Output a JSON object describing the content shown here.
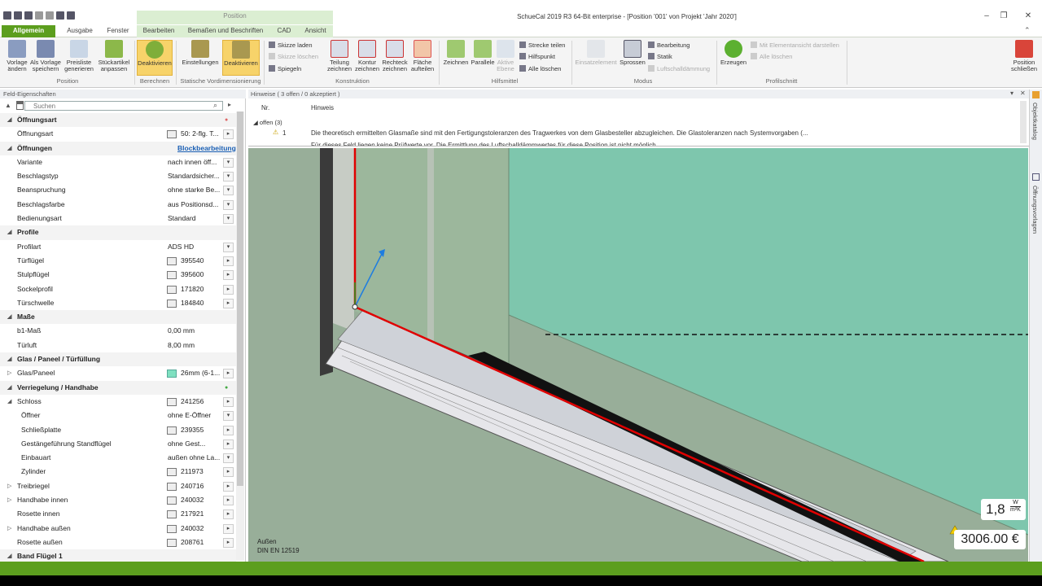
{
  "window": {
    "title": "SchueCal 2019 R3 64-Bit enterprise - [Position '001' von Projekt 'Jahr 2020']",
    "context_group": "Position"
  },
  "tabs": [
    "Allgemein",
    "Ausgabe",
    "Fenster",
    "Bearbeiten",
    "Bemaßen und Beschriften",
    "CAD",
    "Ansicht"
  ],
  "ribbon": {
    "position": {
      "b1": "Vorlage ändern",
      "b2": "Als Vorlage speichern",
      "b3": "Preisliste generieren",
      "b4": "Stückartikel anpassen",
      "label": "Position"
    },
    "berechnen": {
      "b1": "Deaktivieren",
      "label": "Berechnen"
    },
    "statik": {
      "b1": "Einstellungen",
      "b2": "Deaktivieren",
      "label": "Statische Vordimensionierung"
    },
    "skizze": {
      "s1": "Skizze laden",
      "s2": "Skizze löschen",
      "s3": "Spiegeln"
    },
    "konstruktion": {
      "b1": "Teilung zeichnen",
      "b2": "Kontur zeichnen",
      "b3": "Rechteck zeichnen",
      "b4": "Fläche aufteilen",
      "label": "Konstruktion"
    },
    "hilfsmittel": {
      "b1": "Zeichnen",
      "b2": "Parallele",
      "b3": "Aktive Ebene",
      "s1": "Strecke teilen",
      "s2": "Hilfspunkt",
      "s3": "Alle löschen",
      "label": "Hilfsmittel"
    },
    "modus": {
      "b1": "Einsatzelement",
      "b2": "Sprossen",
      "s1": "Bearbeitung",
      "s2": "Statik",
      "s3": "Luftschalldämmung",
      "label": "Modus"
    },
    "profilschnitt": {
      "b1": "Erzeugen",
      "s1": "Mit Elementansicht darstellen",
      "s2": "Alle löschen",
      "label": "Profilschnitt"
    },
    "close": {
      "b1": "Position schließen"
    }
  },
  "left_panel": {
    "title": "Feld-Eigenschaften",
    "search_placeholder": "Suchen",
    "rows": [
      {
        "type": "sec",
        "label": "Öffnungsart"
      },
      {
        "type": "row",
        "label": "Öffnungsart",
        "value": "50: 2-flg. T...",
        "icon": true,
        "btn": "▸"
      },
      {
        "type": "sec",
        "label": "Öffnungen",
        "link": "Blockbearbeitung"
      },
      {
        "type": "row",
        "label": "Variante",
        "value": "nach innen öff...",
        "btn": "▾"
      },
      {
        "type": "row",
        "label": "Beschlagstyp",
        "value": "Standardsicher...",
        "btn": "▾"
      },
      {
        "type": "row",
        "label": "Beanspruchung",
        "value": "ohne starke Be...",
        "btn": "▾"
      },
      {
        "type": "row",
        "label": "Beschlagsfarbe",
        "value": "aus Positionsd...",
        "btn": "▾"
      },
      {
        "type": "row",
        "label": "Bedienungsart",
        "value": "Standard",
        "btn": "▾"
      },
      {
        "type": "sec",
        "label": "Profile"
      },
      {
        "type": "row",
        "label": "Profilart",
        "value": "ADS HD",
        "btn": "▾"
      },
      {
        "type": "row",
        "label": "Türflügel",
        "value": "395540",
        "icon": true,
        "btn": "▸"
      },
      {
        "type": "row",
        "label": "Stulpflügel",
        "value": "395600",
        "icon": true,
        "btn": "▸"
      },
      {
        "type": "row",
        "label": "Sockelprofil",
        "value": "171820",
        "icon": true,
        "btn": "▸"
      },
      {
        "type": "row",
        "label": "Türschwelle",
        "value": "184840",
        "icon": true,
        "btn": "▸"
      },
      {
        "type": "sec",
        "label": "Maße"
      },
      {
        "type": "row",
        "label": "b1-Maß",
        "value": "0,00 mm"
      },
      {
        "type": "row",
        "label": "Türluft",
        "value": "8,00 mm"
      },
      {
        "type": "sec",
        "label": "Glas / Paneel / Türfüllung"
      },
      {
        "type": "row",
        "label": "Glas/Paneel",
        "value": "26mm (6-1...",
        "icon": true,
        "btn": "▸",
        "exp": "▷"
      },
      {
        "type": "sec",
        "label": "Verriegelung / Handhabe"
      },
      {
        "type": "row",
        "label": "Schloss",
        "value": "241256",
        "icon": true,
        "btn": "▸",
        "exp": "◢"
      },
      {
        "type": "sub",
        "label": "Öffner",
        "value": "ohne E-Öffner",
        "btn": "▾"
      },
      {
        "type": "sub",
        "label": "Schließplatte",
        "value": "239355",
        "icon": true,
        "btn": "▸"
      },
      {
        "type": "sub",
        "label": "Gestängeführung Standflügel",
        "value": "ohne Gest...",
        "btn": "▸"
      },
      {
        "type": "sub",
        "label": "Einbauart",
        "value": "außen ohne La...",
        "btn": "▾"
      },
      {
        "type": "sub",
        "label": "Zylinder",
        "value": "211973",
        "icon": true,
        "btn": "▸"
      },
      {
        "type": "row",
        "label": "Treibriegel",
        "value": "240716",
        "icon": true,
        "btn": "▸",
        "exp": "▷"
      },
      {
        "type": "row",
        "label": "Handhabe innen",
        "value": "240032",
        "icon": true,
        "btn": "▸",
        "exp": "▷"
      },
      {
        "type": "row",
        "label": "Rosette innen",
        "value": "217921",
        "icon": true,
        "btn": "▸"
      },
      {
        "type": "row",
        "label": "Handhabe außen",
        "value": "240032",
        "icon": true,
        "btn": "▸",
        "exp": "▷"
      },
      {
        "type": "row",
        "label": "Rosette außen",
        "value": "208761",
        "icon": true,
        "btn": "▸"
      },
      {
        "type": "sec",
        "label": "Band Flügel 1"
      }
    ]
  },
  "hints": {
    "title": "Hinweise ( 3 offen / 0 akzeptiert )",
    "col_nr": "Nr.",
    "col_hint": "Hinweis",
    "group": "offen (3)",
    "item1_nr": "1",
    "item1_text": "Die theoretisch ermittelten Glasmaße sind mit den Fertigungstoleranzen des Tragwerkes von dem Glasbesteller abzugleichen. Die Glastoleranzen nach Systemvorgaben (...",
    "item2_text": "Für dieses Feld liegen keine Prüfwerte vor. Die Ermittlung des Luftschalldämmwertes für diese Position ist nicht möglich."
  },
  "viewport": {
    "uvalue": "1,8",
    "unit_top": "W",
    "unit_bottom": "m²K",
    "price": "3006.00 €",
    "side": "Außen",
    "norm": "DIN EN 12519"
  },
  "right_bar": {
    "t1": "Objektkatalog",
    "t2": "Öffnungsvorlagen"
  },
  "colors": {
    "accent": "#5c9e1e",
    "glass": "#7fc8b0",
    "profile_red": "#e00000"
  }
}
